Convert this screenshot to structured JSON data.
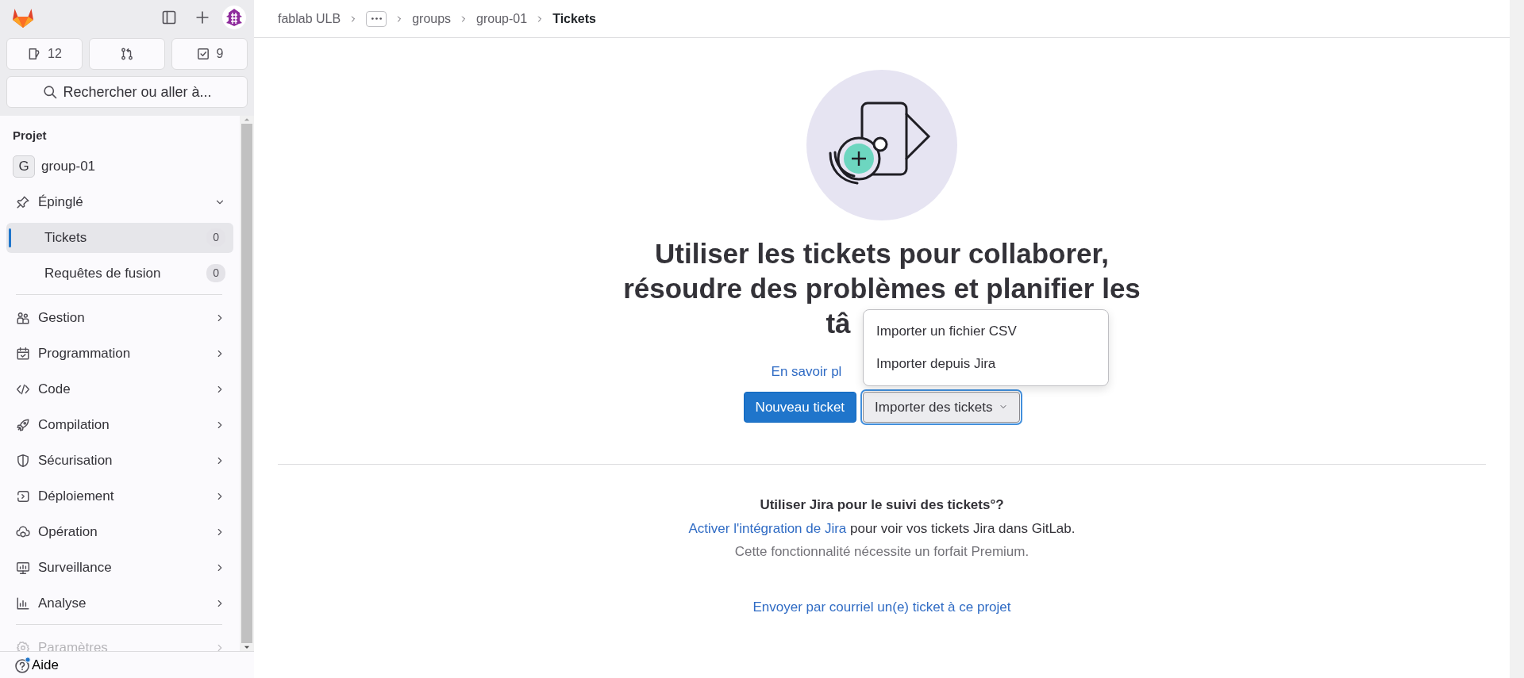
{
  "sidebar": {
    "top_icons": [
      {
        "kind": "logo"
      },
      {
        "kind": "panel"
      },
      {
        "kind": "plus"
      },
      {
        "kind": "avatar"
      }
    ],
    "counters": [
      {
        "kind": "issues",
        "count": "12"
      },
      {
        "kind": "merge_requests"
      },
      {
        "kind": "todos",
        "count": "9"
      }
    ],
    "search": {
      "label": "Rechercher ou aller à..."
    },
    "section_title": "Projet",
    "project": {
      "avatar_letter": "G",
      "name": "group-01"
    },
    "pinned": {
      "label": "Épinglé",
      "expanded": true,
      "items": [
        {
          "label": "Tickets",
          "count": "0",
          "selected": true
        },
        {
          "label": "Requêtes de fusion",
          "count": "0",
          "selected": false
        }
      ]
    },
    "menu": [
      {
        "kind": "people",
        "label": "Gestion",
        "disabled": false
      },
      {
        "kind": "calendar",
        "label": "Programmation",
        "disabled": false
      },
      {
        "kind": "code",
        "label": "Code",
        "disabled": false
      },
      {
        "kind": "rocket",
        "label": "Compilation",
        "disabled": false
      },
      {
        "kind": "shield",
        "label": "Sécurisation",
        "disabled": false
      },
      {
        "kind": "deploy",
        "label": "Déploiement",
        "disabled": false
      },
      {
        "kind": "cloud",
        "label": "Opération",
        "disabled": false
      },
      {
        "kind": "monitor",
        "label": "Surveillance",
        "disabled": false
      },
      {
        "kind": "chart",
        "label": "Analyse",
        "disabled": false
      }
    ],
    "settings": {
      "kind": "gear",
      "label": "Paramètres",
      "disabled": true
    },
    "help": {
      "label": "Aide",
      "notification": true
    }
  },
  "breadcrumb": [
    {
      "kind": "link",
      "label": "fablab ULB"
    },
    {
      "kind": "collapsed"
    },
    {
      "kind": "link",
      "label": "groups"
    },
    {
      "kind": "link",
      "label": "group-01"
    },
    {
      "kind": "current",
      "label": "Tickets"
    }
  ],
  "empty_state": {
    "title_lines": [
      "Utiliser les tickets pour collaborer,",
      "résoudre des problèmes et planifier les",
      "tâ"
    ],
    "learn_more": "En savoir pl",
    "primary_button": "Nouveau ticket",
    "import_button": {
      "label": "Importer des tickets",
      "expanded": true,
      "menu": [
        "Importer un fichier CSV",
        "Importer depuis Jira"
      ]
    },
    "jira": {
      "title": "Utiliser Jira pour le suivi des tickets°?",
      "link": "Activer l'intégration de Jira",
      "text": " pour voir vos tickets Jira dans GitLab.",
      "note": "Cette fonctionnalité nécessite un forfait Premium."
    },
    "email_link": "Envoyer par courriel un(e) ticket à ce projet"
  }
}
